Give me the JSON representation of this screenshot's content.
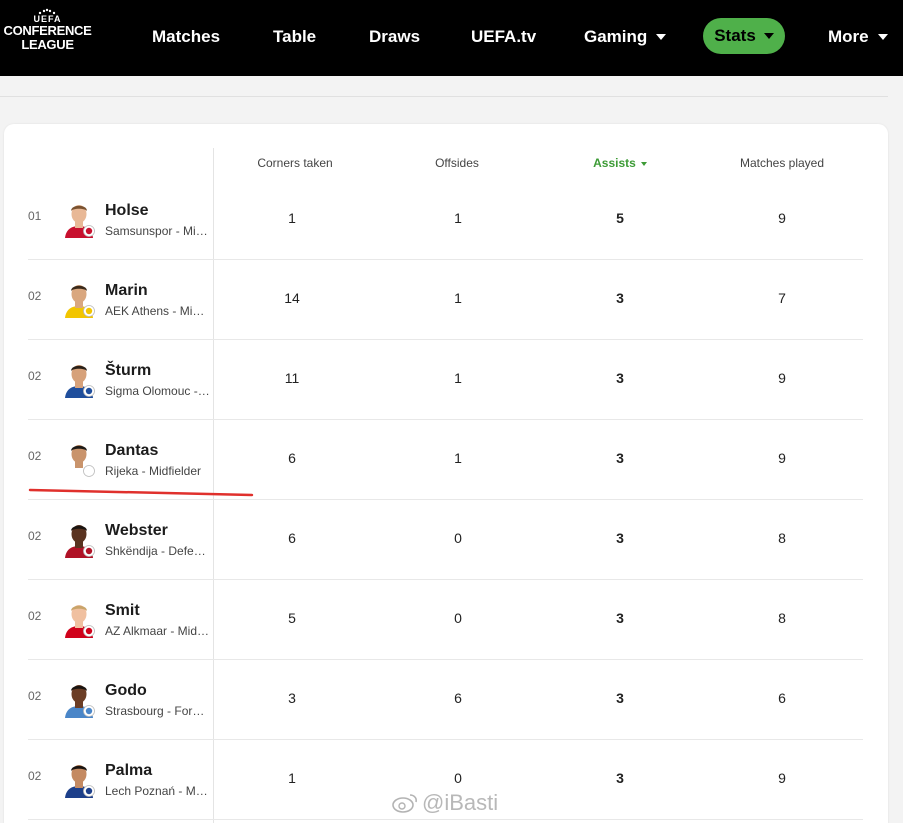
{
  "nav": {
    "logo": {
      "line0": "UEFA",
      "line1": "CONFERENCE",
      "line2": "LEAGUE"
    },
    "items": [
      {
        "label": "Matches",
        "caret": false
      },
      {
        "label": "Table",
        "caret": false
      },
      {
        "label": "Draws",
        "caret": false
      },
      {
        "label": "UEFA.tv",
        "caret": false
      },
      {
        "label": "Gaming",
        "caret": true
      }
    ],
    "stats": {
      "label": "Stats",
      "color": "#4fb04a"
    },
    "more": {
      "label": "More"
    }
  },
  "table": {
    "columns": [
      "Corners taken",
      "Offsides",
      "Assists",
      "Matches played"
    ],
    "active_column": "Assists",
    "active_color": "#3d9b36",
    "rows": [
      {
        "rank": "01",
        "name": "Holse",
        "team": "Samsunspor - Midfielder",
        "corners": "1",
        "offsides": "1",
        "assists": "5",
        "matches": "9",
        "kit": "#c8102e",
        "skin": "#e8b896",
        "hair": "#7a5230"
      },
      {
        "rank": "02",
        "name": "Marin",
        "team": "AEK Athens - Midfielder",
        "corners": "14",
        "offsides": "1",
        "assists": "3",
        "matches": "7",
        "kit": "#f2c500",
        "skin": "#d9a77f",
        "hair": "#3b2a1a"
      },
      {
        "rank": "02",
        "name": "Šturm",
        "team": "Sigma Olomouc - Midfielder",
        "corners": "11",
        "offsides": "1",
        "assists": "3",
        "matches": "9",
        "kit": "#1f4e9c",
        "skin": "#d6a17a",
        "hair": "#2a2018"
      },
      {
        "rank": "02",
        "name": "Dantas",
        "team": "Rijeka - Midfielder",
        "corners": "6",
        "offsides": "1",
        "assists": "3",
        "matches": "9",
        "kit": "#ffffff",
        "skin": "#c9946c",
        "hair": "#1e1a16"
      },
      {
        "rank": "02",
        "name": "Webster",
        "team": "Shkëndija - Defender",
        "corners": "6",
        "offsides": "0",
        "assists": "3",
        "matches": "8",
        "kit": "#b01226",
        "skin": "#5a3320",
        "hair": "#1a1410"
      },
      {
        "rank": "02",
        "name": "Smit",
        "team": "AZ Alkmaar - Midfielder",
        "corners": "5",
        "offsides": "0",
        "assists": "3",
        "matches": "8",
        "kit": "#d0021b",
        "skin": "#f0c0a0",
        "hair": "#c9a46a"
      },
      {
        "rank": "02",
        "name": "Godo",
        "team": "Strasbourg - Forward",
        "corners": "3",
        "offsides": "6",
        "assists": "3",
        "matches": "6",
        "kit": "#4a86c8",
        "skin": "#6b3d25",
        "hair": "#1a1410"
      },
      {
        "rank": "02",
        "name": "Palma",
        "team": "Lech Poznań - Midfielder",
        "corners": "1",
        "offsides": "0",
        "assists": "3",
        "matches": "9",
        "kit": "#1d3f8a",
        "skin": "#c48a62",
        "hair": "#1a1410"
      }
    ]
  },
  "watermark": "@iBasti"
}
